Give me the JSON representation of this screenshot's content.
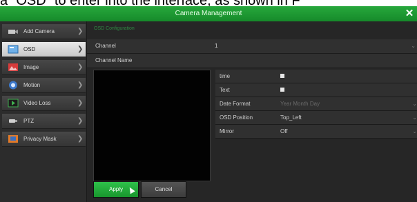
{
  "doc_text": "a   “OSD” to enter into the interface, as shown in F",
  "window": {
    "title": "Camera Management",
    "close_glyph": "✕"
  },
  "sidebar": {
    "items": [
      {
        "label": "Add Camera",
        "icon": "camera-add-icon"
      },
      {
        "label": "OSD",
        "icon": "osd-icon"
      },
      {
        "label": "Image",
        "icon": "image-icon"
      },
      {
        "label": "Motion",
        "icon": "motion-icon"
      },
      {
        "label": "Video Loss",
        "icon": "video-loss-icon"
      },
      {
        "label": "PTZ",
        "icon": "ptz-icon"
      },
      {
        "label": "Privacy Mask",
        "icon": "privacy-mask-icon"
      }
    ],
    "active_index": 1,
    "arrow_glyph": "❯"
  },
  "main": {
    "breadcrumb": "OSD Configuration",
    "channel_label": "Channel",
    "channel_value": "1",
    "channel_name_label": "Channel Name",
    "props": {
      "time_label": "time",
      "text_label": "Text",
      "date_format_label": "Date Format",
      "date_format_value": "Year Month Day",
      "osd_position_label": "OSD Position",
      "osd_position_value": "Top_Left",
      "mirror_label": "Mirror",
      "mirror_value": "Off"
    },
    "chevron_glyph": "⌄",
    "apply_label": "Apply",
    "cancel_label": "Cancel"
  },
  "colors": {
    "accent": "#1f9a34",
    "background": "#2a2a2a"
  }
}
